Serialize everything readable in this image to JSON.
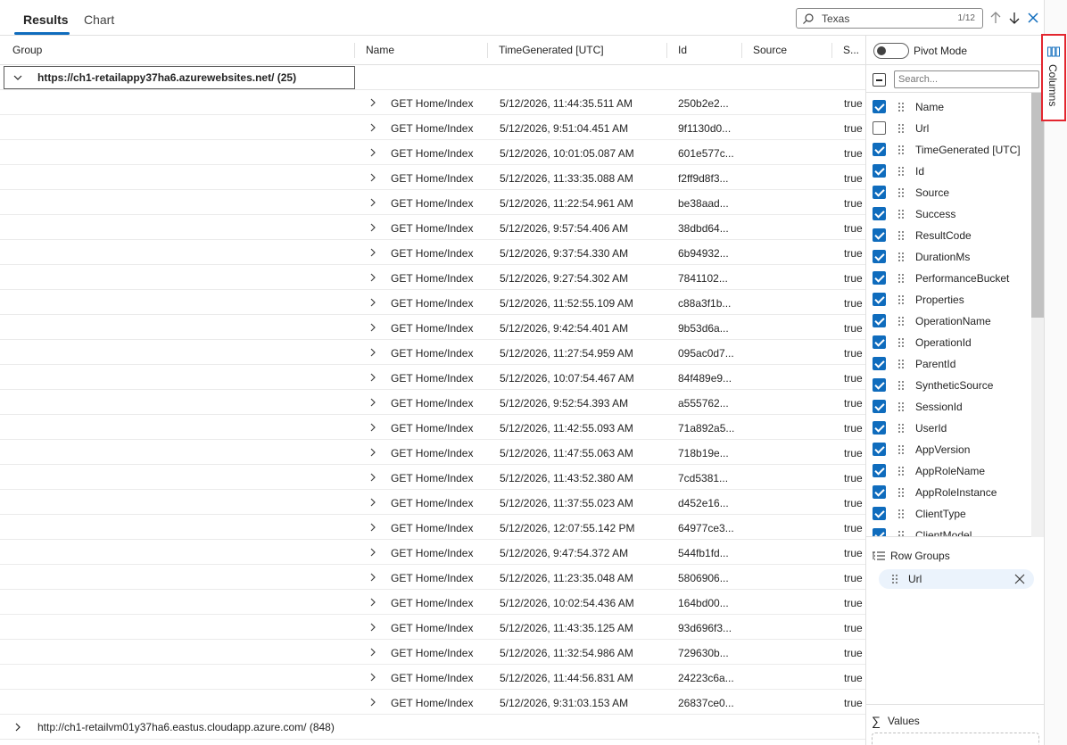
{
  "tabs": [
    {
      "label": "Results",
      "active": true
    },
    {
      "label": "Chart",
      "active": false
    }
  ],
  "search": {
    "value": "Texas",
    "count": "1/12"
  },
  "columns": [
    "Group",
    "Name",
    "TimeGenerated [UTC]",
    "Id",
    "Source",
    "S..."
  ],
  "groups": [
    {
      "label": "https://ch1-retailappy37ha6.azurewebsites.net/ (25)",
      "expanded": true
    },
    {
      "label": "http://ch1-retailvm01y37ha6.eastus.cloudapp.azure.com/ (848)",
      "expanded": false
    }
  ],
  "rows": [
    {
      "name": "GET Home/Index",
      "time": "5/12/2026, 11:44:35.511 AM",
      "id": "250b2e2...",
      "success": "true"
    },
    {
      "name": "GET Home/Index",
      "time": "5/12/2026, 9:51:04.451 AM",
      "id": "9f1130d0...",
      "success": "true"
    },
    {
      "name": "GET Home/Index",
      "time": "5/12/2026, 10:01:05.087 AM",
      "id": "601e577c...",
      "success": "true"
    },
    {
      "name": "GET Home/Index",
      "time": "5/12/2026, 11:33:35.088 AM",
      "id": "f2ff9d8f3...",
      "success": "true"
    },
    {
      "name": "GET Home/Index",
      "time": "5/12/2026, 11:22:54.961 AM",
      "id": "be38aad...",
      "success": "true"
    },
    {
      "name": "GET Home/Index",
      "time": "5/12/2026, 9:57:54.406 AM",
      "id": "38dbd64...",
      "success": "true"
    },
    {
      "name": "GET Home/Index",
      "time": "5/12/2026, 9:37:54.330 AM",
      "id": "6b94932...",
      "success": "true"
    },
    {
      "name": "GET Home/Index",
      "time": "5/12/2026, 9:27:54.302 AM",
      "id": "7841102...",
      "success": "true"
    },
    {
      "name": "GET Home/Index",
      "time": "5/12/2026, 11:52:55.109 AM",
      "id": "c88a3f1b...",
      "success": "true"
    },
    {
      "name": "GET Home/Index",
      "time": "5/12/2026, 9:42:54.401 AM",
      "id": "9b53d6a...",
      "success": "true"
    },
    {
      "name": "GET Home/Index",
      "time": "5/12/2026, 11:27:54.959 AM",
      "id": "095ac0d7...",
      "success": "true"
    },
    {
      "name": "GET Home/Index",
      "time": "5/12/2026, 10:07:54.467 AM",
      "id": "84f489e9...",
      "success": "true"
    },
    {
      "name": "GET Home/Index",
      "time": "5/12/2026, 9:52:54.393 AM",
      "id": "a555762...",
      "success": "true"
    },
    {
      "name": "GET Home/Index",
      "time": "5/12/2026, 11:42:55.093 AM",
      "id": "71a892a5...",
      "success": "true"
    },
    {
      "name": "GET Home/Index",
      "time": "5/12/2026, 11:47:55.063 AM",
      "id": "718b19e...",
      "success": "true"
    },
    {
      "name": "GET Home/Index",
      "time": "5/12/2026, 11:43:52.380 AM",
      "id": "7cd5381...",
      "success": "true"
    },
    {
      "name": "GET Home/Index",
      "time": "5/12/2026, 11:37:55.023 AM",
      "id": "d452e16...",
      "success": "true"
    },
    {
      "name": "GET Home/Index",
      "time": "5/12/2026, 12:07:55.142 PM",
      "id": "64977ce3...",
      "success": "true"
    },
    {
      "name": "GET Home/Index",
      "time": "5/12/2026, 9:47:54.372 AM",
      "id": "544fb1fd...",
      "success": "true"
    },
    {
      "name": "GET Home/Index",
      "time": "5/12/2026, 11:23:35.048 AM",
      "id": "5806906...",
      "success": "true"
    },
    {
      "name": "GET Home/Index",
      "time": "5/12/2026, 10:02:54.436 AM",
      "id": "164bd00...",
      "success": "true"
    },
    {
      "name": "GET Home/Index",
      "time": "5/12/2026, 11:43:35.125 AM",
      "id": "93d696f3...",
      "success": "true"
    },
    {
      "name": "GET Home/Index",
      "time": "5/12/2026, 11:32:54.986 AM",
      "id": "729630b...",
      "success": "true"
    },
    {
      "name": "GET Home/Index",
      "time": "5/12/2026, 11:44:56.831 AM",
      "id": "24223c6a...",
      "success": "true"
    },
    {
      "name": "GET Home/Index",
      "time": "5/12/2026, 9:31:03.153 AM",
      "id": "26837ce0...",
      "success": "true"
    }
  ],
  "panel": {
    "pivot_label": "Pivot Mode",
    "search_placeholder": "Search...",
    "column_items": [
      {
        "name": "Name",
        "checked": true
      },
      {
        "name": "Url",
        "checked": false
      },
      {
        "name": "TimeGenerated [UTC]",
        "checked": true
      },
      {
        "name": "Id",
        "checked": true
      },
      {
        "name": "Source",
        "checked": true
      },
      {
        "name": "Success",
        "checked": true
      },
      {
        "name": "ResultCode",
        "checked": true
      },
      {
        "name": "DurationMs",
        "checked": true
      },
      {
        "name": "PerformanceBucket",
        "checked": true
      },
      {
        "name": "Properties",
        "checked": true
      },
      {
        "name": "OperationName",
        "checked": true
      },
      {
        "name": "OperationId",
        "checked": true
      },
      {
        "name": "ParentId",
        "checked": true
      },
      {
        "name": "SyntheticSource",
        "checked": true
      },
      {
        "name": "SessionId",
        "checked": true
      },
      {
        "name": "UserId",
        "checked": true
      },
      {
        "name": "AppVersion",
        "checked": true
      },
      {
        "name": "AppRoleName",
        "checked": true
      },
      {
        "name": "AppRoleInstance",
        "checked": true
      },
      {
        "name": "ClientType",
        "checked": true
      },
      {
        "name": "ClientModel",
        "checked": true
      }
    ],
    "row_groups_title": "Row Groups",
    "row_group_pill": "Url",
    "values_title": "Values"
  },
  "side_strip": {
    "columns_label": "Columns"
  },
  "colors": {
    "accent": "#0f6cbd",
    "highlight_border": "#e3262f",
    "pill_bg": "#ebf3fc"
  },
  "icons": [
    "search-icon",
    "arrow-up-icon",
    "arrow-down-icon",
    "close-icon",
    "chevron-down-icon",
    "chevron-right-icon",
    "grip-icon",
    "row-groups-icon",
    "sigma-icon",
    "columns-icon"
  ]
}
